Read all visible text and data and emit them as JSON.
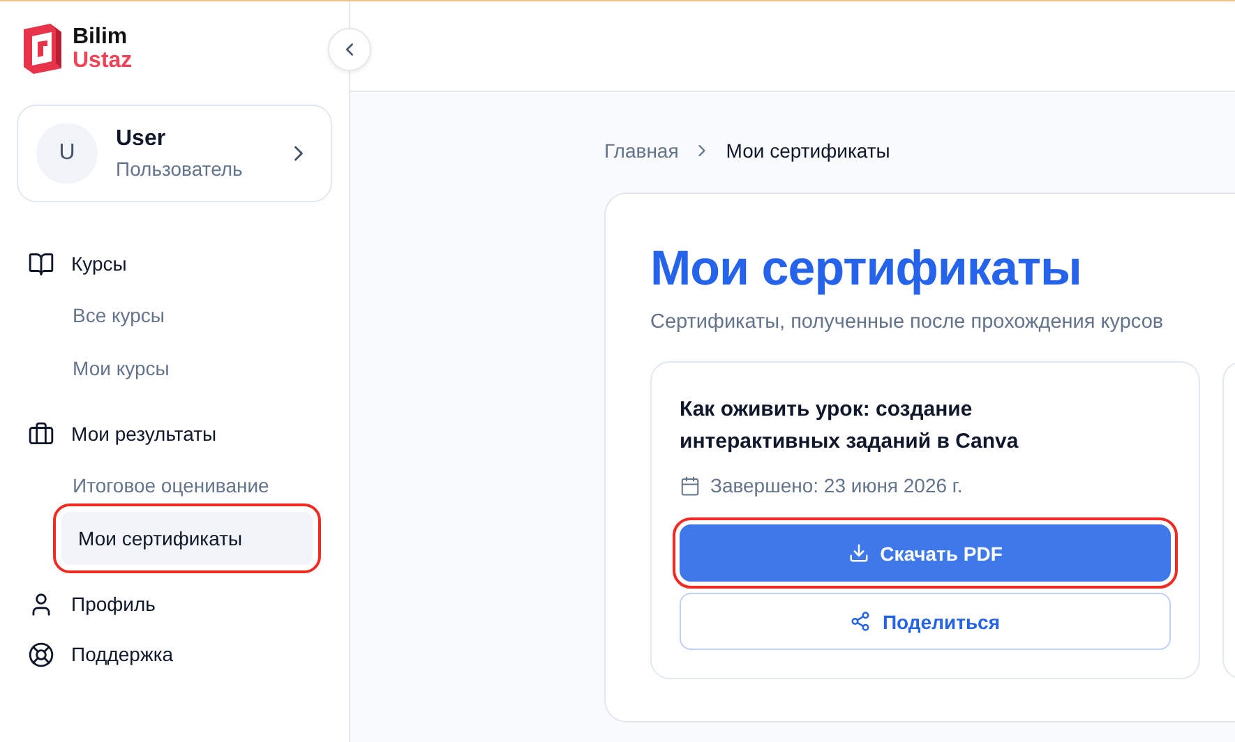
{
  "logo": {
    "line1": "Bilim",
    "line2": "Ustaz"
  },
  "user": {
    "initial": "U",
    "name": "User",
    "role": "Пользователь"
  },
  "nav": [
    {
      "label": "Курсы",
      "kind": "book",
      "children": [
        {
          "label": "Все курсы",
          "selected": false,
          "highlighted": false
        },
        {
          "label": "Мои курсы",
          "selected": false,
          "highlighted": false
        }
      ]
    },
    {
      "label": "Мои результаты",
      "kind": "briefcase",
      "children": [
        {
          "label": "Итоговое оценивание",
          "selected": false,
          "highlighted": false
        },
        {
          "label": "Мои сертификаты",
          "selected": true,
          "highlighted": true
        }
      ]
    },
    {
      "label": "Профиль",
      "kind": "user"
    },
    {
      "label": "Поддержка",
      "kind": "lifebuoy"
    }
  ],
  "breadcrumb": [
    "Главная",
    "Мои сертификаты"
  ],
  "page": {
    "title": "Мои сертификаты",
    "subtitle": "Сертификаты, полученные после прохождения курсов"
  },
  "certificates": [
    {
      "title": "Как оживить урок: создание интерактивных заданий в Canva",
      "date": "Завершено: 23 июня 2026 г.",
      "download": {
        "label": "Скачать PDF",
        "highlighted": true
      },
      "share": {
        "label": "Поделиться"
      }
    }
  ]
}
